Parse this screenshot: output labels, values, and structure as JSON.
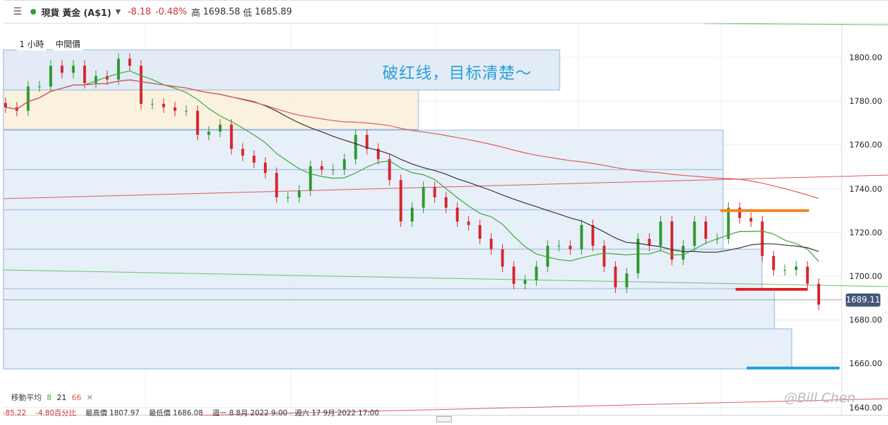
{
  "header": {
    "menu_icon": "hamburger-icon",
    "status_color": "#2aa02a",
    "title": "現貨 黃金 (A$1)",
    "change": "-8.18",
    "change_pct": "-0.48%",
    "high_label": "高",
    "high": "1698.58",
    "low_label": "低",
    "low": "1685.89"
  },
  "toolbar": {
    "timeframe": "1 小時",
    "price_type": "中間價"
  },
  "annotation": "破红线，目标清楚～",
  "moving_average": {
    "label": "移動平均",
    "p1": "8",
    "p2": "21",
    "p3": "66",
    "colors": [
      "#3aa83a",
      "#333333",
      "#e05a5a"
    ],
    "close_icon": "✕"
  },
  "stats": {
    "change": "-85.22",
    "change_pct": "-4.80百分比",
    "highest": "最高價 1807.97",
    "lowest": "最低價 1686.08",
    "range": "週一 8 8月 2022 9:00 - 週六 17 9月 2022 17:00"
  },
  "last_price": "1689.11",
  "watermark": "@Bill Chen",
  "chart_data": {
    "type": "candlestick",
    "ylim": [
      1635,
      1805
    ],
    "yticks": [
      "1800.00",
      "1780.00",
      "1760.00",
      "1740.00",
      "1720.00",
      "1700.00",
      "1680.00",
      "1660.00",
      "1640.00"
    ],
    "grid": true,
    "moving_averages": [
      8,
      21,
      66
    ],
    "closes": [
      1777.2,
      1775.6,
      1786.7,
      1786.7,
      1796.2,
      1793.0,
      1796.2,
      1788.3,
      1791.5,
      1789.9,
      1799.4,
      1796.2,
      1778.8,
      1778.8,
      1777.2,
      1775.6,
      1775.6,
      1764.6,
      1766.1,
      1769.3,
      1758.2,
      1755.1,
      1751.9,
      1747.2,
      1736.1,
      1736.1,
      1739.2,
      1750.3,
      1748.7,
      1748.7,
      1753.5,
      1764.6,
      1758.2,
      1753.5,
      1744.0,
      1725.0,
      1731.3,
      1740.8,
      1736.1,
      1731.3,
      1725.0,
      1723.4,
      1717.1,
      1712.3,
      1704.4,
      1696.5,
      1698.1,
      1704.4,
      1713.9,
      1713.9,
      1712.3,
      1723.4,
      1713.9,
      1704.4,
      1694.9,
      1701.3,
      1717.1,
      1713.9,
      1725.0,
      1707.6,
      1713.9,
      1725.0,
      1717.1,
      1717.1,
      1731.3,
      1726.6,
      1725.0,
      1709.2,
      1702.8,
      1702.8,
      1704.4,
      1696.5,
      1687.0
    ],
    "levels": {
      "orange": 1730,
      "red": 1694,
      "blue": 1658
    }
  }
}
